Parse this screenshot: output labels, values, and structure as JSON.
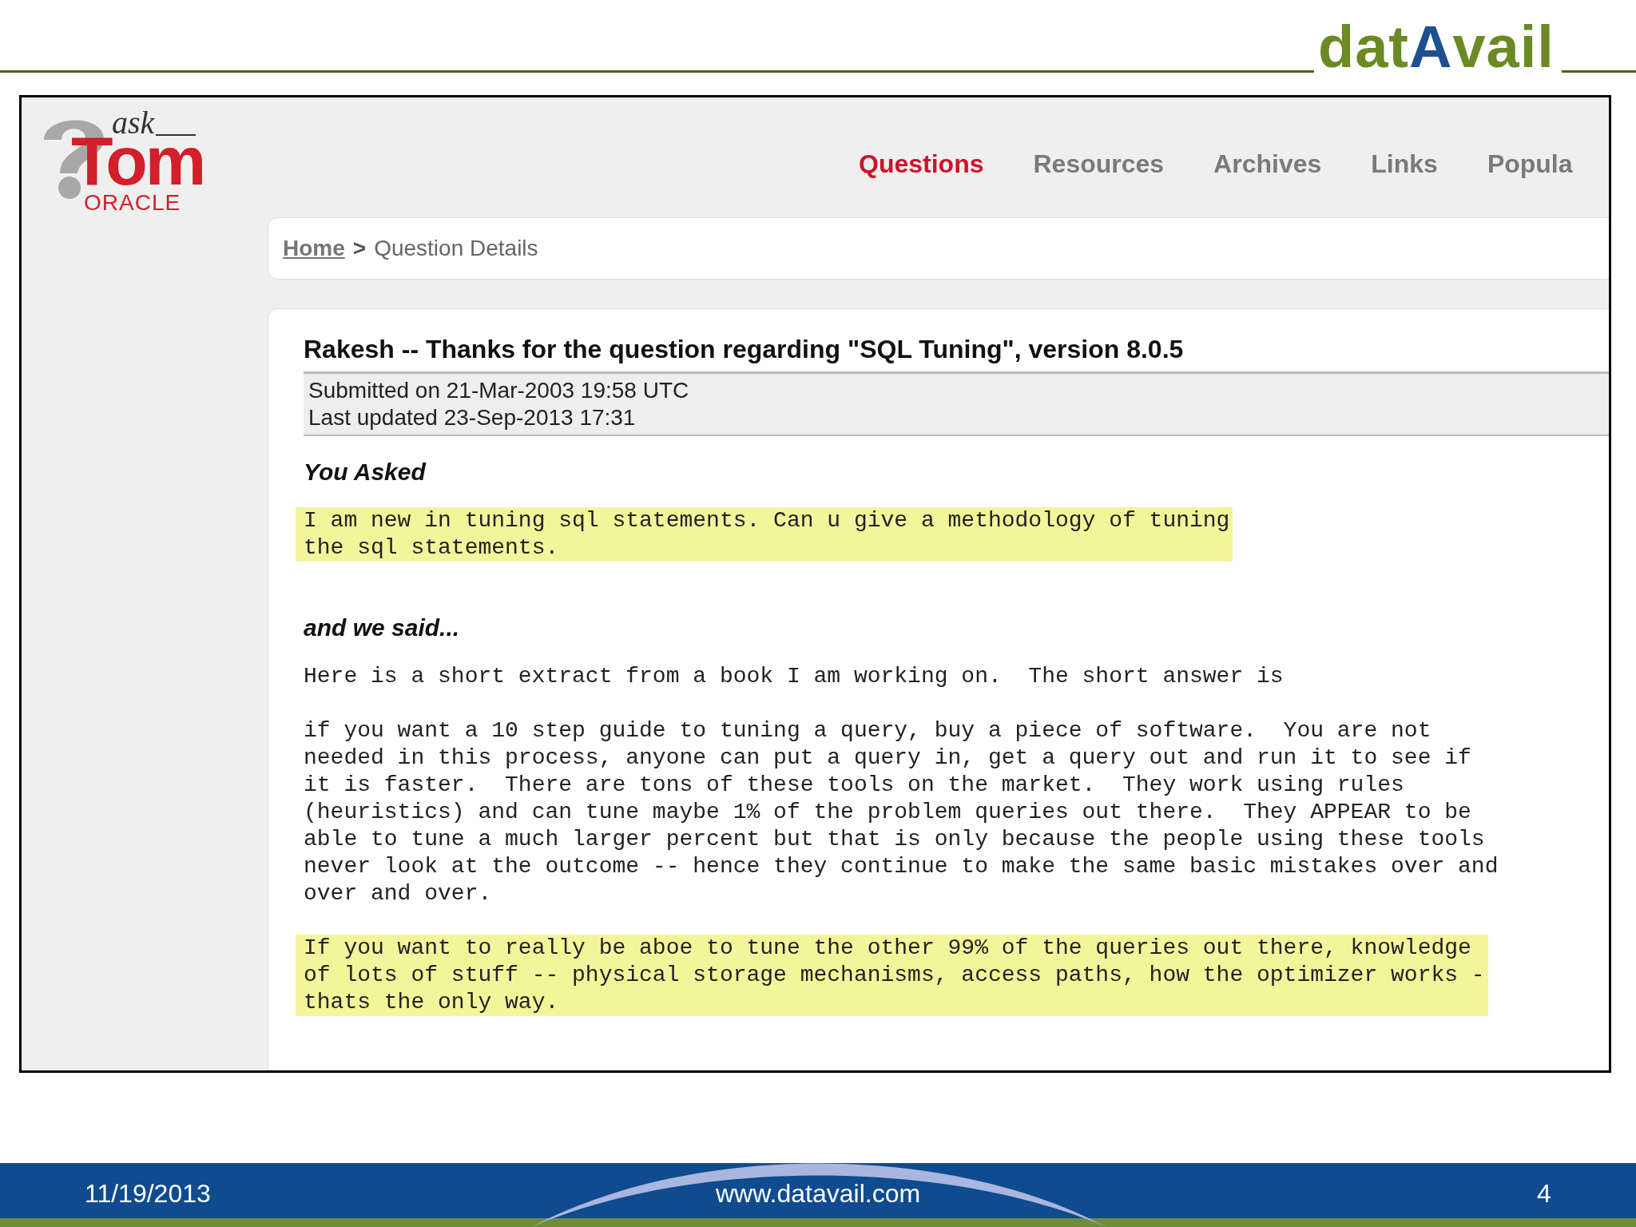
{
  "brand_logo": [
    "dat",
    "A",
    "vail"
  ],
  "screenshot": {
    "site_logo": {
      "small": "ask",
      "large": "Tom",
      "sub": "ORACLE"
    },
    "nav": [
      {
        "label": "Questions",
        "selected": true
      },
      {
        "label": "Resources",
        "selected": false
      },
      {
        "label": "Archives",
        "selected": false
      },
      {
        "label": "Links",
        "selected": false
      },
      {
        "label": "Popula",
        "selected": false
      }
    ],
    "breadcrumb": {
      "link": "Home",
      "separator": ">",
      "current": "Question Details"
    },
    "question": {
      "title": "Rakesh -- Thanks for the question regarding \"SQL Tuning\", version 8.0.5",
      "meta": [
        "Submitted on 21-Mar-2003 19:58 UTC",
        "Last updated 23-Sep-2013 17:31"
      ],
      "sections": [
        {
          "heading": "You Asked",
          "paragraphs": [
            {
              "highlighted": true,
              "lines": [
                "I am new in tuning sql statements. Can u give a methodology of tuning",
                "the sql statements."
              ]
            }
          ]
        },
        {
          "heading": "and we said...",
          "paragraphs": [
            {
              "highlighted": false,
              "lines": [
                "Here is a short extract from a book I am working on.  The short answer is"
              ]
            },
            {
              "highlighted": false,
              "lines": [
                "if you want a 10 step guide to tuning a query, buy a piece of software.  You are not",
                "needed in this process, anyone can put a query in, get a query out and run it to see if",
                "it is faster.  There are tons of these tools on the market.  They work using rules",
                "(heuristics) and can tune maybe 1% of the problem queries out there.  They APPEAR to be",
                "able to tune a much larger percent but that is only because the people using these tools",
                "never look at the outcome -- hence they continue to make the same basic mistakes over and",
                "over and over."
              ]
            },
            {
              "highlighted": true,
              "lines": [
                "If you want to really be aboe to tune the other 99% of the queries out there, knowledge",
                "of lots of stuff -- physical storage mechanisms, access paths, how the optimizer works -",
                "thats the only way."
              ]
            }
          ]
        }
      ]
    }
  },
  "footer": {
    "date": "11/19/2013",
    "url": "www.datavail.com",
    "page": "4"
  }
}
